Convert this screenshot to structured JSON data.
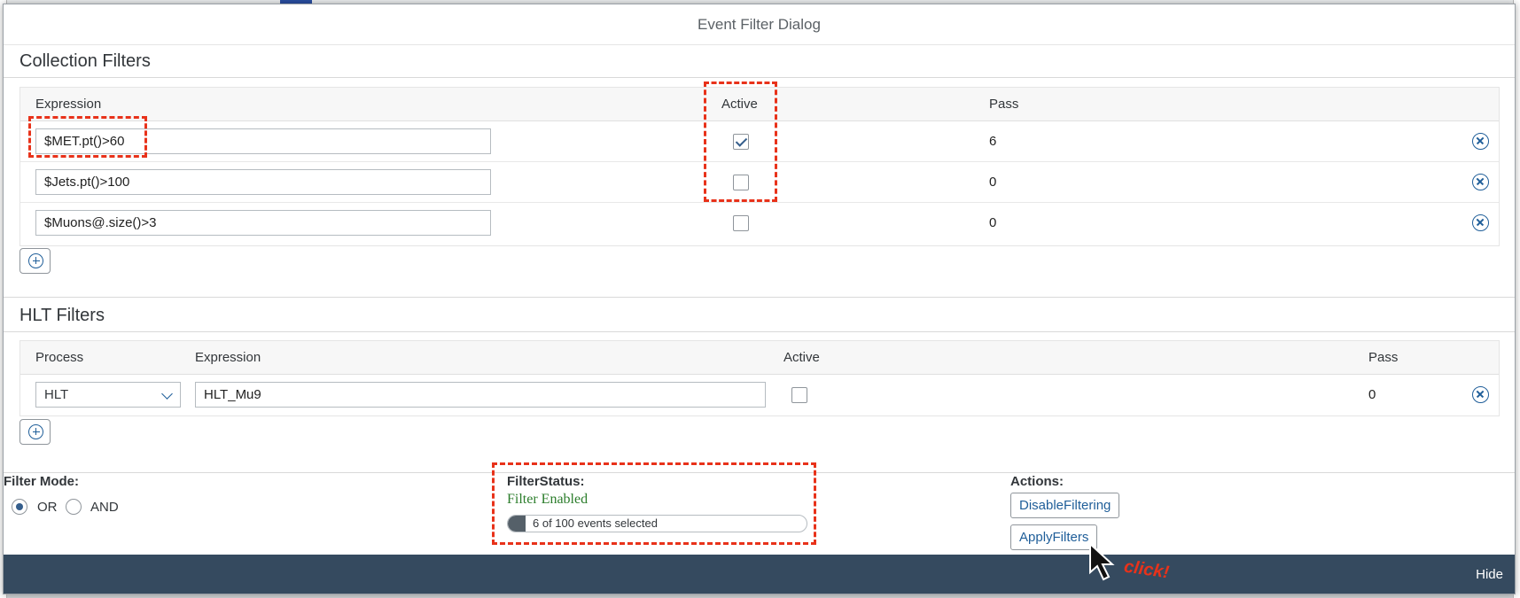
{
  "dialog": {
    "title": "Event Filter Dialog"
  },
  "collection": {
    "title": "Collection Filters",
    "headers": {
      "expression": "Expression",
      "active": "Active",
      "pass": "Pass"
    },
    "rows": [
      {
        "expression": "$MET.pt()>60",
        "active": true,
        "pass": "6"
      },
      {
        "expression": "$Jets.pt()>100",
        "active": false,
        "pass": "0"
      },
      {
        "expression": "$Muons@.size()>3",
        "active": false,
        "pass": "0"
      }
    ]
  },
  "hlt": {
    "title": "HLT Filters",
    "headers": {
      "process": "Process",
      "expression": "Expression",
      "active": "Active",
      "pass": "Pass"
    },
    "rows": [
      {
        "process": "HLT",
        "expression": "HLT_Mu9",
        "active": false,
        "pass": "0"
      }
    ]
  },
  "filter_mode": {
    "label": "Filter Mode:",
    "options": [
      {
        "label": "OR",
        "selected": true
      },
      {
        "label": "AND",
        "selected": false
      }
    ]
  },
  "filter_status": {
    "label": "FilterStatus:",
    "status": "Filter Enabled",
    "progress_text": "6 of 100 events selected",
    "progress_fraction": 0.06
  },
  "actions": {
    "label": "Actions:",
    "disable": "DisableFiltering",
    "apply": "ApplyFilters"
  },
  "footer": {
    "hide": "Hide"
  },
  "annotation": {
    "click_text": "click!",
    "color": "#e8321a"
  },
  "colors": {
    "accent": "#1f5e99",
    "footer": "#354a5f",
    "status_green": "#2b7d2b"
  }
}
